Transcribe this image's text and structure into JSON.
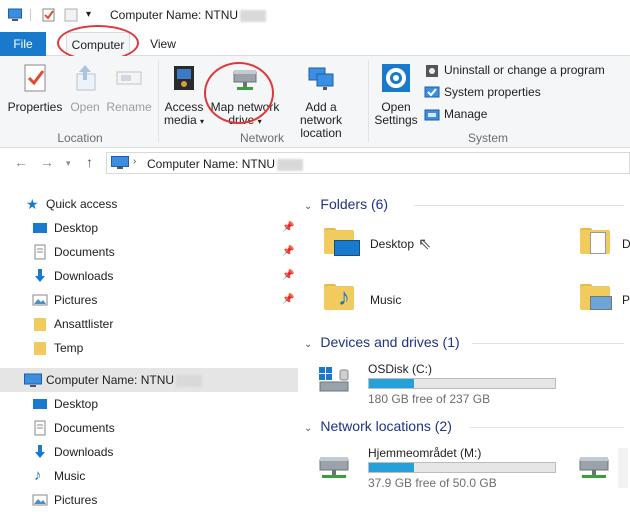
{
  "title": {
    "prefix": "Computer Name:",
    "name": "NTNU"
  },
  "tabs": {
    "file": "File",
    "computer": "Computer",
    "view": "View"
  },
  "ribbon": {
    "properties": "Properties",
    "open": "Open",
    "rename": "Rename",
    "location_group": "Location",
    "access_media_1": "Access",
    "access_media_2": "media",
    "map_drive_1": "Map network",
    "map_drive_2": "drive",
    "add_location_1": "Add a network",
    "add_location_2": "location",
    "network_group": "Network",
    "open_settings_1": "Open",
    "open_settings_2": "Settings",
    "uninstall": "Uninstall or change a program",
    "system_properties": "System properties",
    "manage": "Manage",
    "system_group": "System",
    "dropdown_arrow": "▾"
  },
  "address": {
    "prefix": "Computer Name:",
    "name": "NTNU"
  },
  "nav": {
    "quick_access": "Quick access",
    "qa_items": [
      "Desktop",
      "Documents",
      "Downloads",
      "Pictures",
      "Ansattlister",
      "Temp"
    ],
    "pc": "Computer Name:",
    "pc_name": "NTNU",
    "pc_items": [
      "Desktop",
      "Documents",
      "Downloads",
      "Music",
      "Pictures"
    ]
  },
  "content": {
    "folders_header": "Folders (6)",
    "folders": [
      "Desktop",
      "D",
      "Music",
      "P"
    ],
    "devices_header": "Devices and drives (1)",
    "drive_name": "OSDisk (C:)",
    "drive_free": "180 GB free of 237 GB",
    "drive_used_fraction": 0.24,
    "network_header": "Network locations (2)",
    "net_name": "Hjemmeområdet (M:)",
    "net_free": "37.9 GB free of 50.0 GB",
    "net_used_fraction": 0.24
  },
  "colors": {
    "accent": "#1979ca",
    "highlight": "#e0373a",
    "bar": "#26a0da"
  }
}
